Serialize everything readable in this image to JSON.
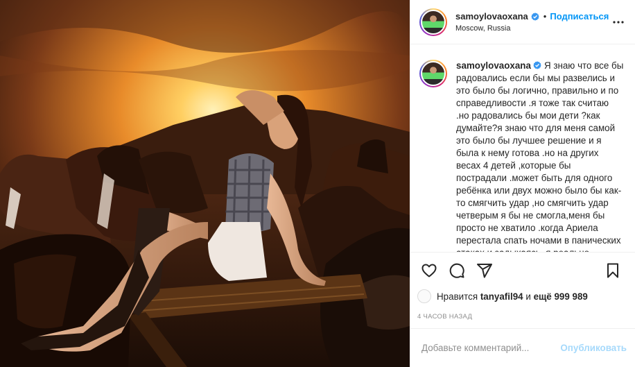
{
  "post": {
    "username": "samoylovaoxana",
    "follow_label": "Подписаться",
    "location": "Moscow, Russia",
    "caption": "Я знаю что все бы радовались если бы мы развелись и это было бы логично, правильно и по справедливости .я тоже так считаю .но радовались бы мои дети ?как думайте?я знаю что для меня самой это было бы лучшее решение и я была к нему готова .но на других весах 4 детей ,которые бы пострадали .может быть для одного ребёнка или двух можно было бы как-то смягчить удар ,но смягчить удар четверым я бы не смогла,меня бы просто не хватило .когда Ариела перестала спать ночами в панических атаках и задыхаясь .я реально испугалась ,но я к этому",
    "likes_prefix": "Нравится",
    "likes_user": "tanyafil94",
    "likes_joiner": "и",
    "likes_rest": "ещё 999 989",
    "time_ago": "4 часов назад"
  },
  "comment_box": {
    "placeholder": "Добавьте комментарий...",
    "publish_label": "Опубликовать"
  },
  "icons": {
    "verified": "verified-badge-icon",
    "more": "more-options-icon",
    "like": "heart-icon",
    "comment": "comment-icon",
    "share": "share-icon",
    "save": "bookmark-icon"
  },
  "colors": {
    "accent": "#0095f6",
    "text": "#262626",
    "muted": "#8e8e8e",
    "border": "#efefef"
  }
}
